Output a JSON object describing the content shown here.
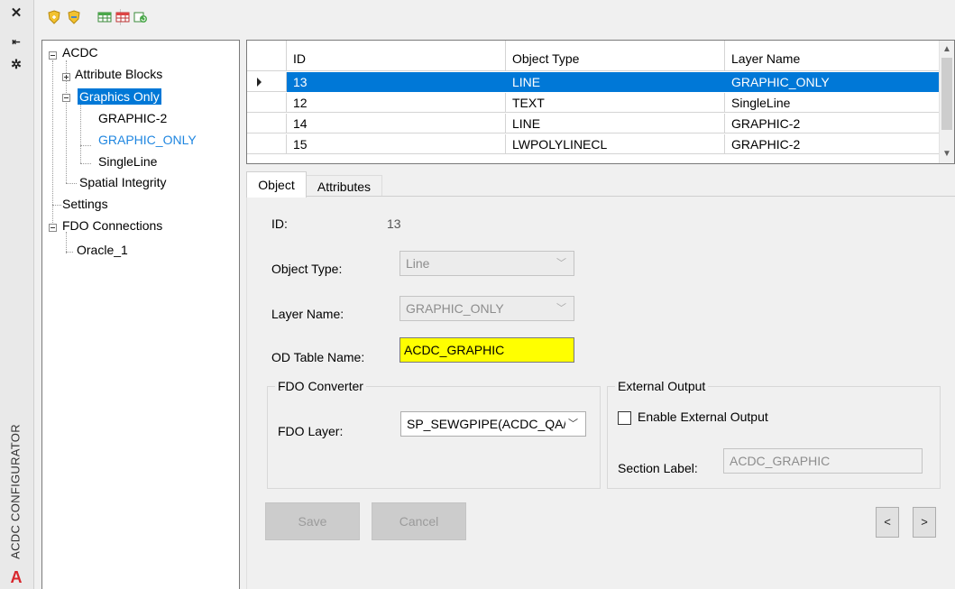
{
  "palette": {
    "title": "ACDC CONFIGURATOR",
    "close_icon": "close-icon",
    "pin_icon": "pin-icon",
    "settings_icon": "settings-icon",
    "logo_letter": "A",
    "logo_color": "#d8262c"
  },
  "tree": {
    "root": "ACDC",
    "attribute_blocks": "Attribute Blocks",
    "graphics_only": "Graphics Only",
    "graphic_2": "GRAPHIC-2",
    "graphic_only": "GRAPHIC_ONLY",
    "singleline": "SingleLine",
    "spatial_integrity": "Spatial Integrity",
    "settings": "Settings",
    "fdo_connections": "FDO Connections",
    "oracle_1": "Oracle_1"
  },
  "grid": {
    "columns": [
      "ID",
      "Object Type",
      "Layer Name"
    ],
    "rows": [
      {
        "id": "13",
        "type": "LINE",
        "layer": "GRAPHIC_ONLY",
        "selected": true
      },
      {
        "id": "12",
        "type": "TEXT",
        "layer": "SingleLine",
        "selected": false
      },
      {
        "id": "14",
        "type": "LINE",
        "layer": "GRAPHIC-2",
        "selected": false
      },
      {
        "id": "15",
        "type": "LWPOLYLINECL",
        "layer": "GRAPHIC-2",
        "selected": false
      }
    ]
  },
  "tabs": {
    "object": "Object",
    "attributes": "Attributes"
  },
  "form": {
    "id_label": "ID:",
    "id_value": "13",
    "object_type_label": "Object Type:",
    "object_type_value": "Line",
    "layer_name_label": "Layer Name:",
    "layer_name_value": "GRAPHIC_ONLY",
    "od_table_label": "OD Table Name:",
    "od_table_value": "ACDC_GRAPHIC",
    "fdo_group_title": "FDO Converter",
    "fdo_layer_label": "FDO Layer:",
    "fdo_layer_value": "SP_SEWGPIPE(ACDC_QA/",
    "ext_group_title": "External Output",
    "enable_ext_label": "Enable External Output",
    "enable_ext_checked": false,
    "section_label": "Section Label:",
    "section_value": "ACDC_GRAPHIC"
  },
  "buttons": {
    "save": "Save",
    "cancel": "Cancel",
    "prev": "<",
    "next": ">"
  },
  "colors": {
    "selection": "#0078d7",
    "highlight_text": "#1f86e0",
    "od_table_bg": "#ffff00"
  }
}
